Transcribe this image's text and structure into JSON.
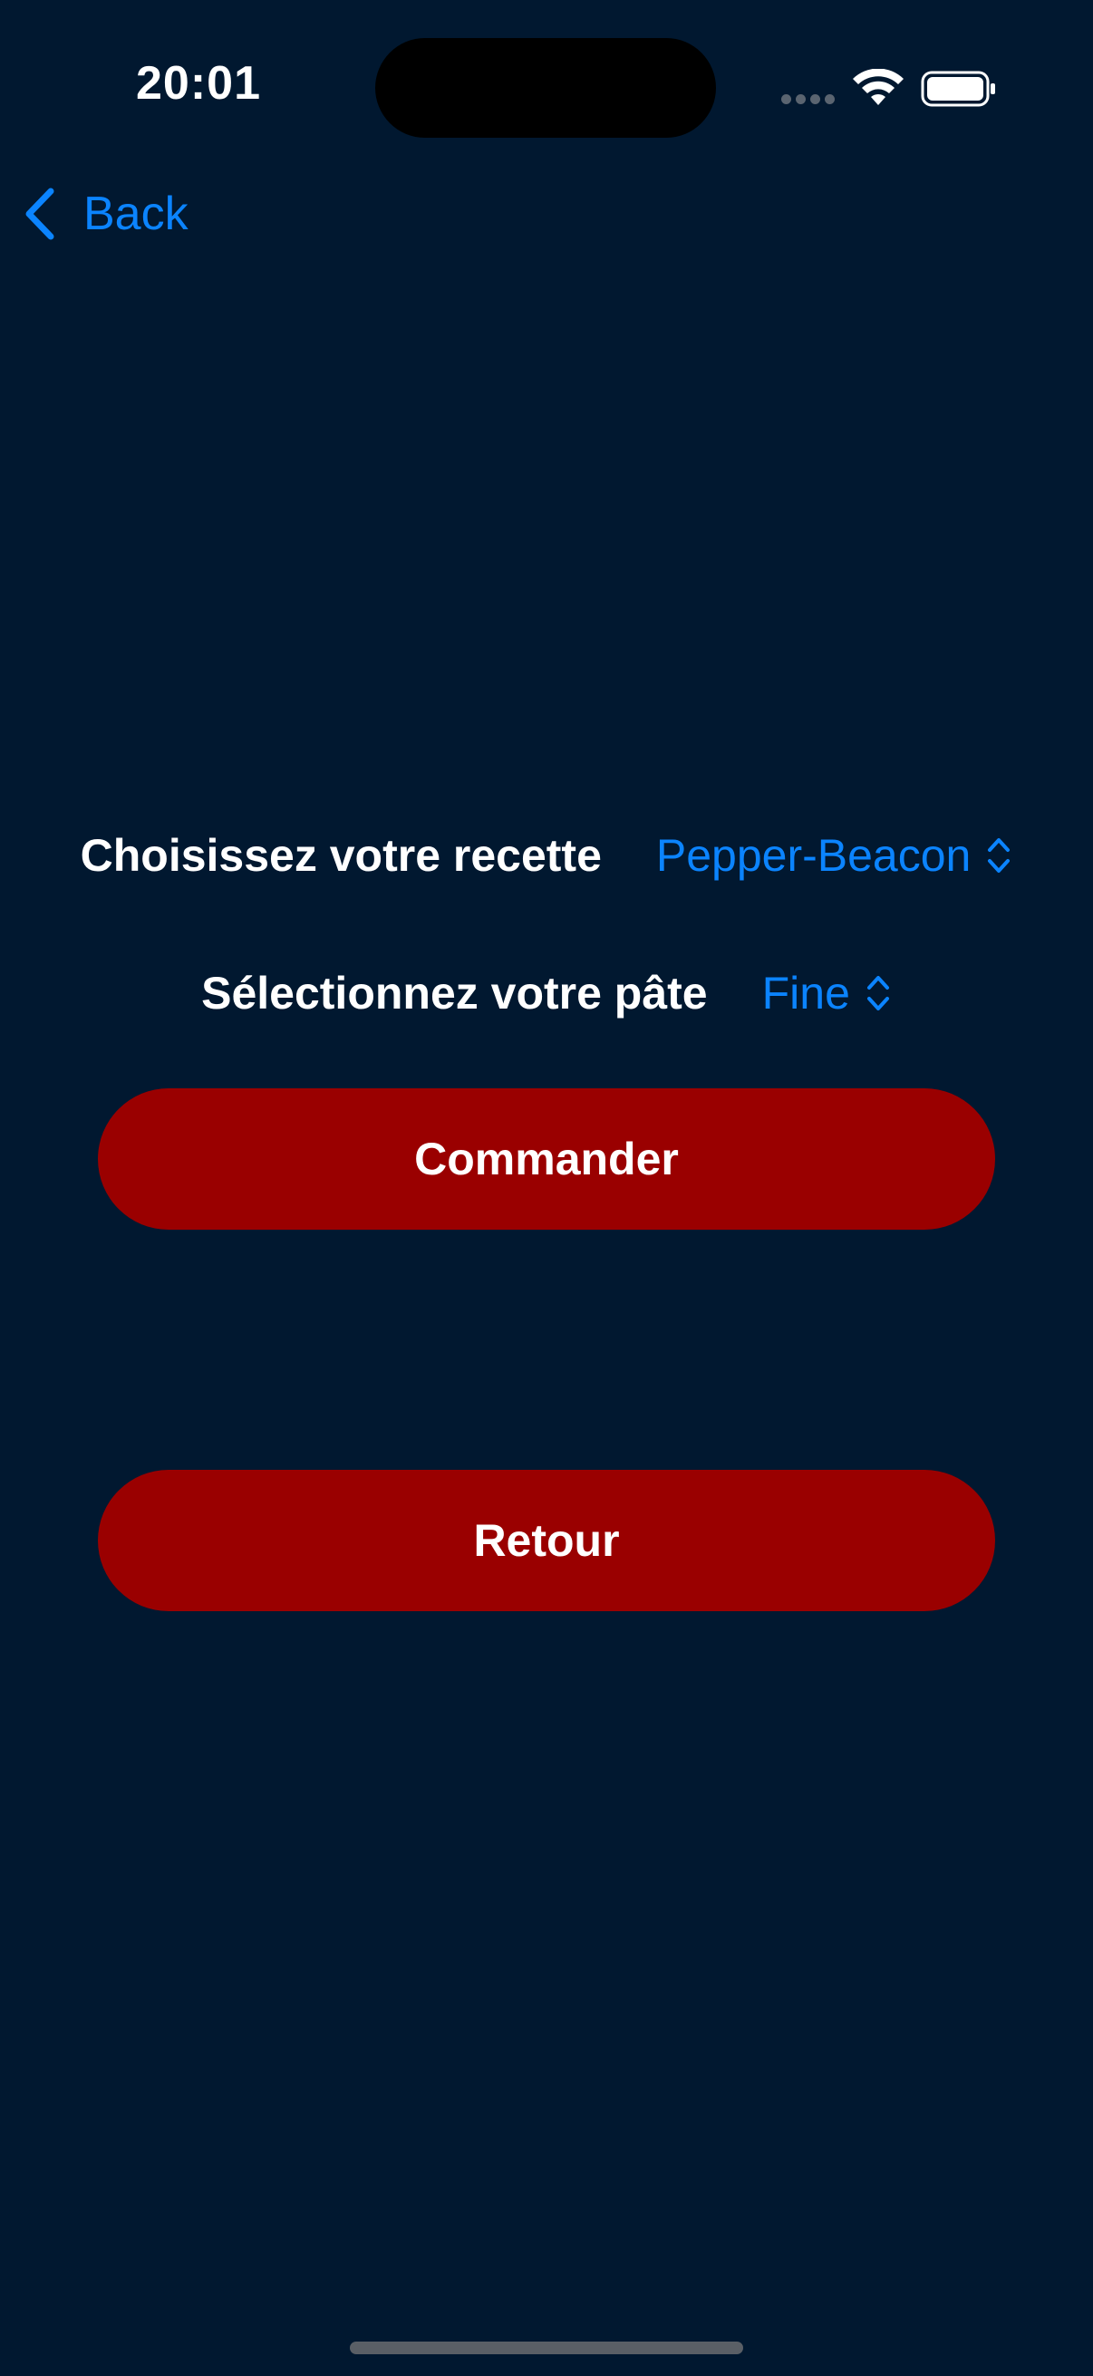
{
  "status_bar": {
    "time": "20:01",
    "icons": [
      "signal-dots-icon",
      "wifi-icon",
      "battery-icon"
    ]
  },
  "nav": {
    "back_label": "Back",
    "back_icon": "chevron-left-icon"
  },
  "form": {
    "recipe": {
      "label": "Choisissez votre recette",
      "value": "Pepper-Beacon",
      "icon": "chevron-up-down-icon"
    },
    "dough": {
      "label": "Sélectionnez votre pâte",
      "value": "Fine",
      "icon": "chevron-up-down-icon"
    }
  },
  "actions": {
    "order_label": "Commander",
    "return_label": "Retour"
  },
  "colors": {
    "background": "#011830",
    "accent": "#0b84ff",
    "button": "#9a0000",
    "text": "#ffffff"
  }
}
